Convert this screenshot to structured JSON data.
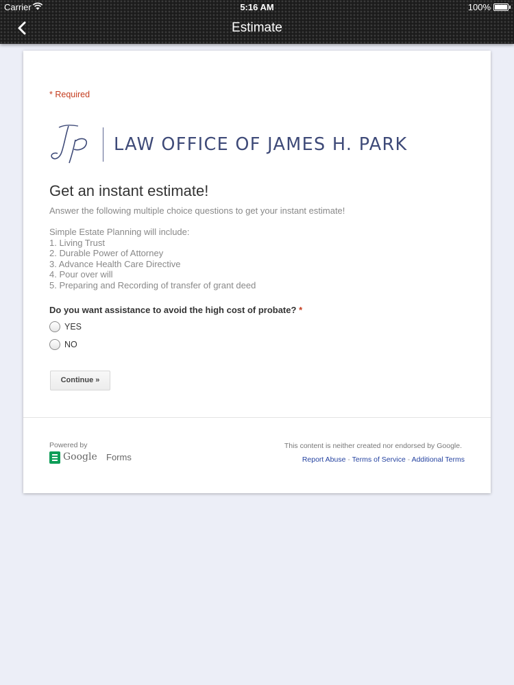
{
  "status_bar": {
    "carrier": "Carrier",
    "time": "5:16 AM",
    "battery": "100%"
  },
  "nav": {
    "title": "Estimate",
    "back_icon": "chevron-left-icon"
  },
  "form": {
    "required_note": "* Required",
    "logo": {
      "monogram": "Jp",
      "firm_name": "LAW OFFICE OF JAMES H. PARK"
    },
    "title": "Get an instant estimate!",
    "description": "Answer the following multiple choice questions to get your instant estimate!",
    "details": {
      "intro": "Simple Estate Planning will include:",
      "items": [
        "1. Living Trust",
        "2. Durable Power of Attorney",
        "3. Advance Health Care Directive",
        "4. Pour over will",
        "5. Preparing and Recording of transfer of grant deed"
      ]
    },
    "question": {
      "text": "Do you want assistance to avoid the high cost of probate?",
      "required_mark": "*",
      "options": [
        "YES",
        "NO"
      ]
    },
    "continue_label": "Continue »"
  },
  "footer": {
    "powered_by": "Powered by",
    "brand_google": "Google",
    "brand_forms": "Forms",
    "disclaimer": "This content is neither created nor endorsed by Google.",
    "links": [
      "Report Abuse",
      "Terms of Service",
      "Additional Terms"
    ],
    "link_separator": " - "
  },
  "colors": {
    "nav_bg": "#1c1c1c",
    "page_bg": "#eceef7",
    "required_red": "#c43b1d",
    "logo_navy": "#3e4a78",
    "link_blue": "#2442a0",
    "forms_green": "#0f9d58"
  }
}
